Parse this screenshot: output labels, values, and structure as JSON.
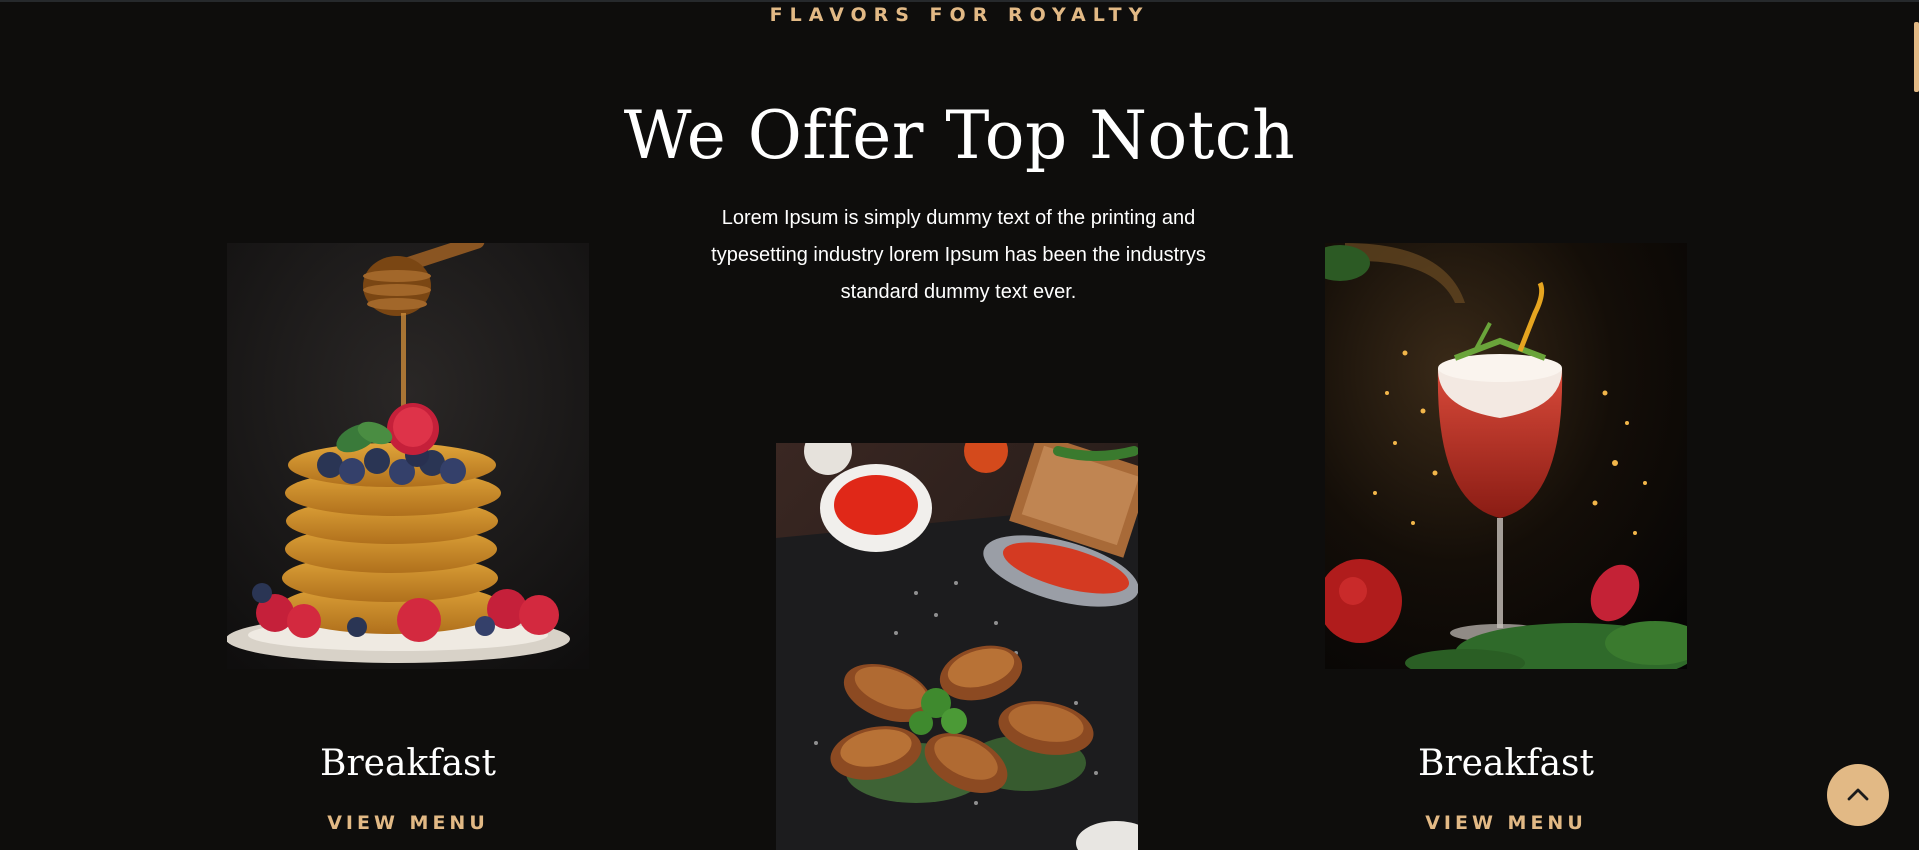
{
  "section": {
    "eyebrow": "FLAVORS FOR ROYALTY",
    "title": "We Offer Top Notch",
    "description": "Lorem Ipsum is simply dummy text of the printing and typesetting industry lorem Ipsum has been the industrys standard dummy text ever."
  },
  "cards": [
    {
      "title": "Breakfast",
      "link_label": "VIEW MENU",
      "image": "pancakes-with-honey-photo"
    },
    {
      "title": "",
      "link_label": "",
      "image": "grilled-chicken-wings-photo"
    },
    {
      "title": "Breakfast",
      "link_label": "VIEW MENU",
      "image": "red-cocktail-photo"
    }
  ],
  "colors": {
    "background": "#0e0d0c",
    "accent": "#e2b985",
    "text": "#ffffff"
  },
  "icons": {
    "back_to_top": "chevron-up-icon"
  }
}
